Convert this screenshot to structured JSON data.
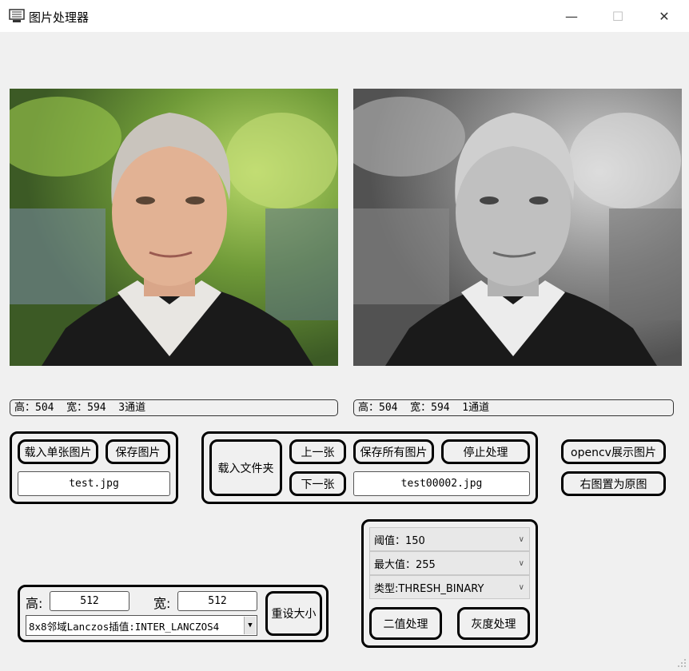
{
  "window": {
    "title": "图片处理器",
    "minimize": "—",
    "maximize": "☐",
    "close": "✕",
    "icon": "monitor-icon"
  },
  "left_info": "高：504  宽：594  3通道",
  "right_info": "高：504  宽：594  1通道",
  "single_group": {
    "load_single": "载入单张图片",
    "save_image": "保存图片",
    "filename": "test.jpg"
  },
  "folder_group": {
    "load_folder": "载入文件夹",
    "prev": "上一张",
    "next": "下一张",
    "save_all": "保存所有图片",
    "stop": "停止处理",
    "current_file": "test00002.jpg"
  },
  "side_buttons": {
    "opencv_show": "opencv展示图片",
    "reset_right": "右图置为原图"
  },
  "threshold_group": {
    "threshold": "阈值：150",
    "max_value": "最大值：255",
    "type": "类型:THRESH_BINARY",
    "binary": "二值处理",
    "gray": "灰度处理"
  },
  "resize_group": {
    "height_label": "高:",
    "height_value": "512",
    "width_label": "宽:",
    "width_value": "512",
    "interpolation": "8x8邻域Lanczos插值:INTER_LANCZOS4",
    "resize_button": "重设大小"
  },
  "colors": {
    "window_bg": "#f0f0f0",
    "titlebar_bg": "#ffffff",
    "border": "#000000"
  }
}
